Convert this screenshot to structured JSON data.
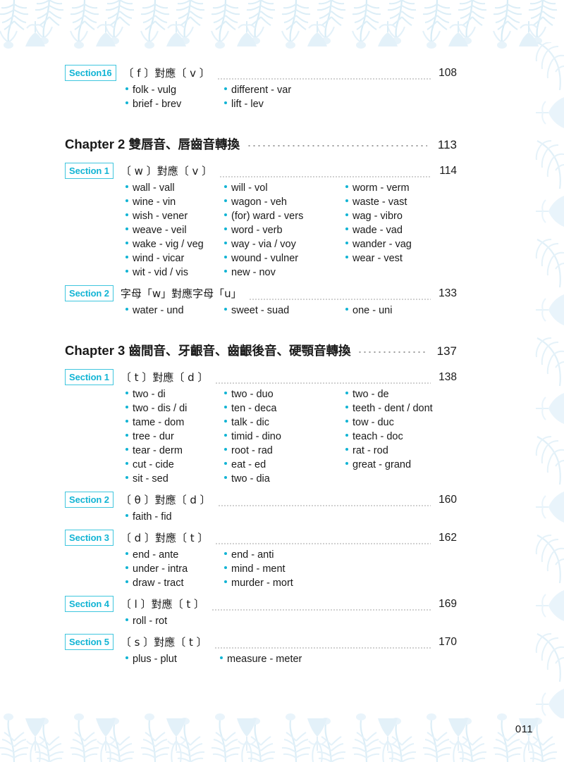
{
  "page": {
    "folio": "011",
    "accent_color": "#12b4d4",
    "badge_border_color": "#3fc6de",
    "text_color": "#1a1a1a",
    "decoration_color": "#dceef7"
  },
  "blocks": [
    {
      "kind": "section",
      "badge": "Section16",
      "title": "〔 f 〕對應〔 v 〕",
      "page": "108",
      "columns": 2,
      "col_class": "cols-2",
      "entries": [
        "folk - vulg",
        "brief - brev",
        "different - var",
        "lift - lev"
      ]
    },
    {
      "kind": "chapter",
      "label": "Chapter 2",
      "title_cn": "雙唇音、唇齒音轉換",
      "page": "113"
    },
    {
      "kind": "section",
      "badge": "Section 1",
      "title": "〔 w 〕對應〔 v 〕",
      "page": "114",
      "columns": 3,
      "col_class": "cols-3",
      "entries": [
        "wall - vall",
        "wine - vin",
        "wish - vener",
        "weave - veil",
        "wake - vig / veg",
        "wind - vicar",
        "wit - vid / vis",
        "will - vol",
        "wagon - veh",
        "(for) ward - vers",
        "word - verb",
        "way - via / voy",
        "wound - vulner",
        "new - nov",
        "worm - verm",
        "waste - vast",
        "wag - vibro",
        "wade - vad",
        "wander - vag",
        "wear - vest"
      ]
    },
    {
      "kind": "section",
      "badge": "Section 2",
      "title": "字母「w」對應字母「u」",
      "page": "133",
      "columns": 3,
      "col_class": "cols-3",
      "entries": [
        "water - und",
        "sweet - suad",
        "one - uni"
      ]
    },
    {
      "kind": "chapter",
      "label": "Chapter 3",
      "title_cn": "齒間音、牙齦音、齒齦後音、硬顎音轉換",
      "page": "137"
    },
    {
      "kind": "section",
      "badge": "Section 1",
      "title": "〔 t 〕對應〔 d 〕",
      "page": "138",
      "columns": 3,
      "col_class": "cols-3",
      "entries": [
        "two - di",
        "two - dis / di",
        "tame - dom",
        "tree - dur",
        "tear - derm",
        "cut - cide",
        "sit - sed",
        "two - duo",
        "ten - deca",
        "talk - dic",
        "timid - dino",
        "root - rad",
        "eat - ed",
        "two - dia",
        "two - de",
        "teeth - dent / dont",
        "tow - duc",
        "teach - doc",
        "rat - rod",
        "great - grand"
      ]
    },
    {
      "kind": "section",
      "badge": "Section 2",
      "title": "〔 θ 〕對應〔 d 〕",
      "page": "160",
      "columns": 1,
      "col_class": "cols-1",
      "entries": [
        "faith - fid"
      ]
    },
    {
      "kind": "section",
      "badge": "Section 3",
      "title": "〔 d 〕對應〔 t 〕",
      "page": "162",
      "columns": 2,
      "col_class": "cols-2",
      "entries": [
        "end - ante",
        "under - intra",
        "draw - tract",
        "end - anti",
        "mind - ment",
        "murder - mort"
      ]
    },
    {
      "kind": "section",
      "badge": "Section 4",
      "title": "〔 l 〕對應〔 t 〕",
      "page": "169",
      "columns": 1,
      "col_class": "cols-1",
      "entries": [
        "roll - rot"
      ]
    },
    {
      "kind": "section",
      "badge": "Section 5",
      "title": "〔 s 〕對應〔 t 〕",
      "page": "170",
      "columns": 2,
      "col_class": "w2-134",
      "entries": [
        "plus - plut",
        "measure - meter"
      ]
    }
  ]
}
